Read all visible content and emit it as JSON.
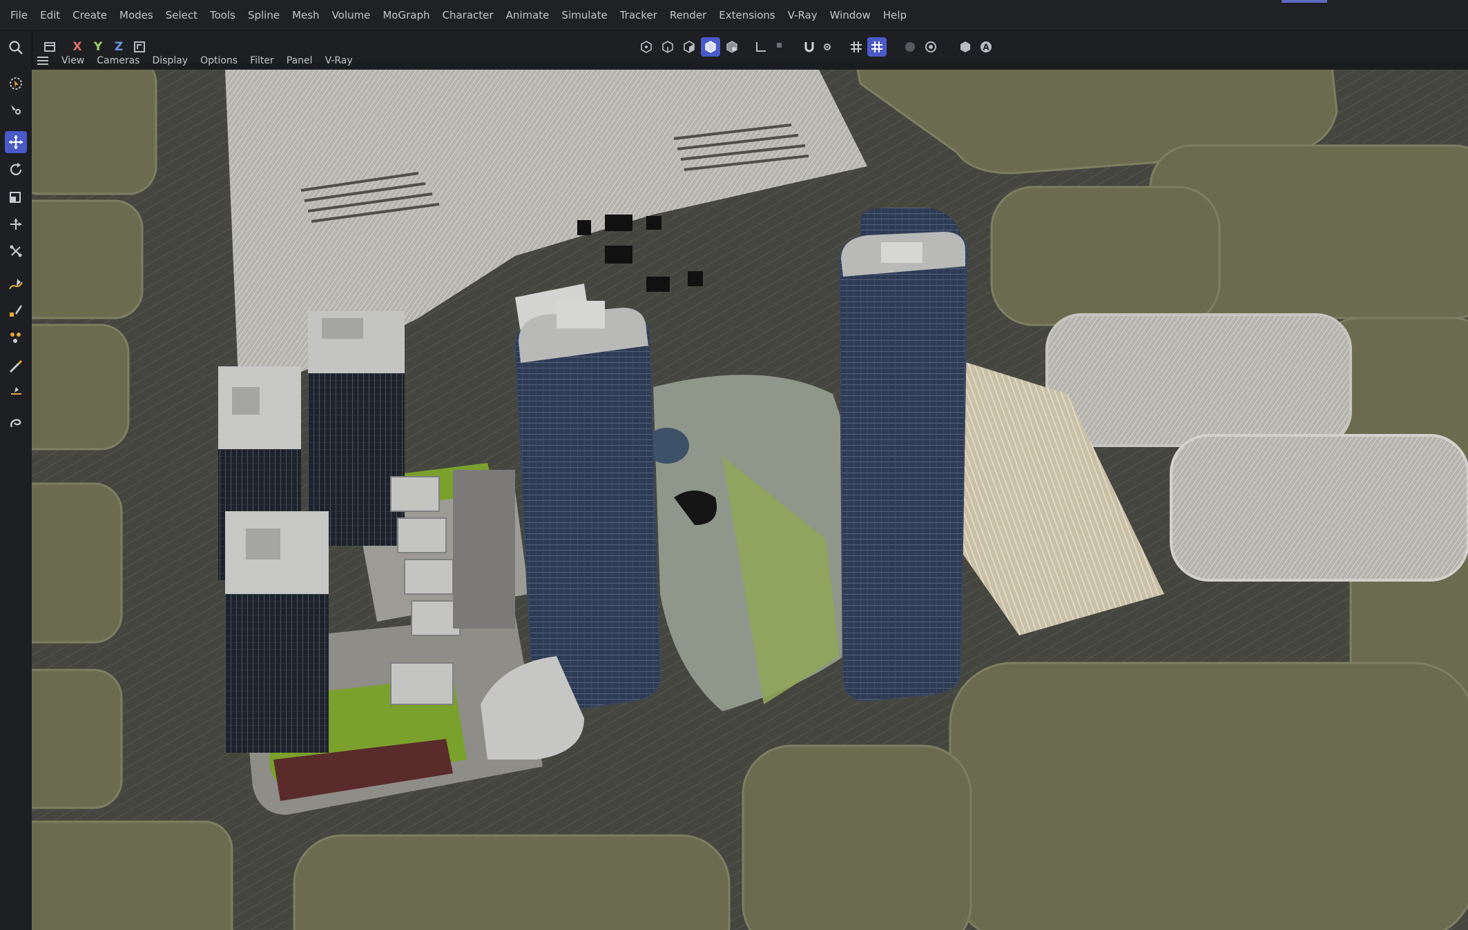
{
  "menubar": {
    "items": [
      "File",
      "Edit",
      "Create",
      "Modes",
      "Select",
      "Tools",
      "Spline",
      "Mesh",
      "Volume",
      "MoGraph",
      "Character",
      "Animate",
      "Simulate",
      "Tracker",
      "Render",
      "Extensions",
      "V-Ray",
      "Window",
      "Help"
    ]
  },
  "toolbar": {
    "axis_x": "X",
    "axis_y": "Y",
    "axis_z": "Z"
  },
  "viewport_menu": {
    "items": [
      "View",
      "Cameras",
      "Display",
      "Options",
      "Filter",
      "Panel",
      "V-Ray"
    ]
  },
  "left_tools": [
    "search-icon",
    "live-selection-icon",
    "tweak-icon",
    "move-icon",
    "rotate-icon",
    "scale-icon",
    "align-move-icon",
    "transfer-icon",
    "spline-pen-icon",
    "sketch-icon",
    "bevel-icon",
    "brush-icon",
    "knife-icon",
    "magnet-icon"
  ],
  "colors": {
    "accent": "#4a5ac8",
    "ground": "#6a6a50",
    "road": "#3e3f3a",
    "tower_glass": "#2c3a52"
  }
}
